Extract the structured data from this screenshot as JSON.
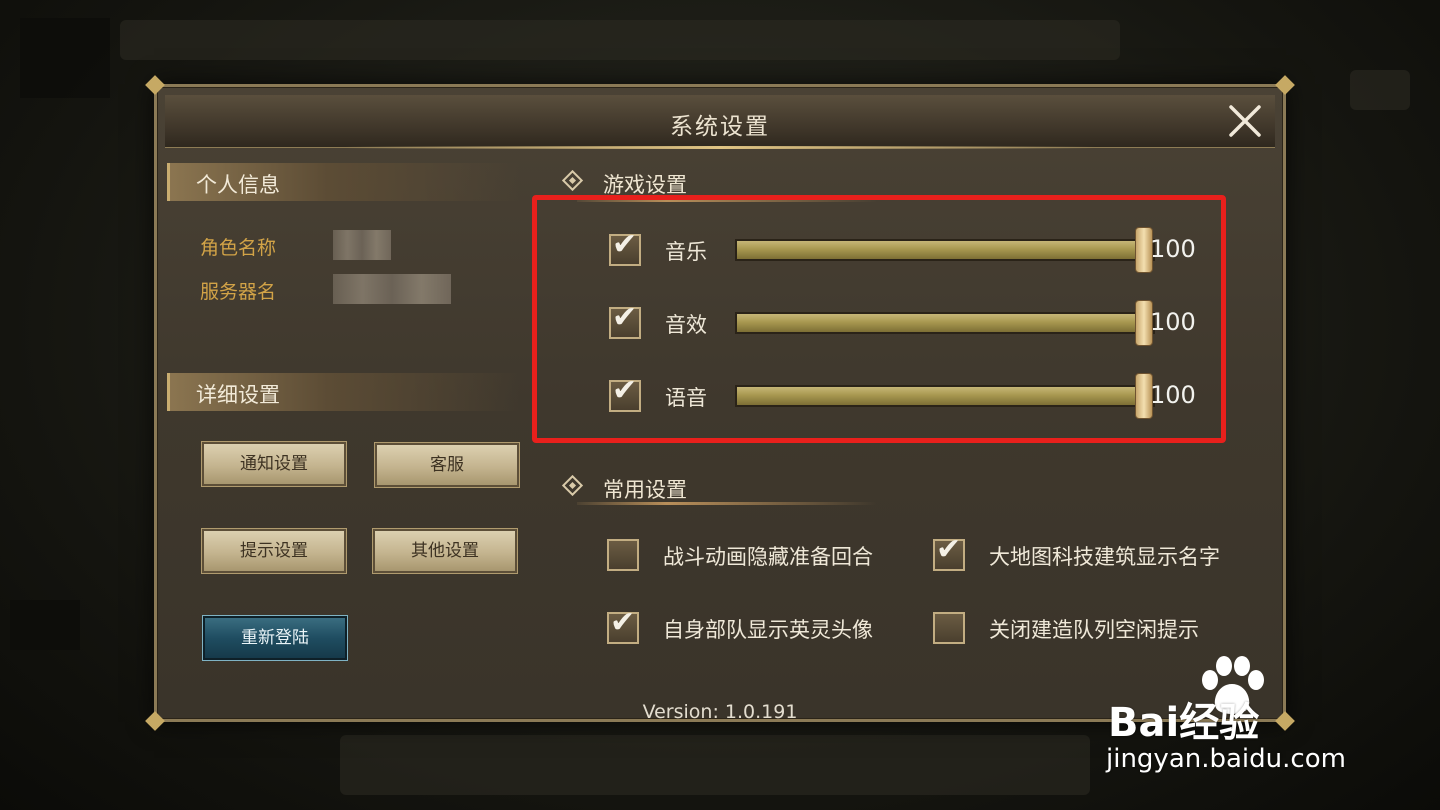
{
  "dialog": {
    "title": "系统设置",
    "close_icon": "close-icon"
  },
  "personal": {
    "section_title": "个人信息",
    "role_label": "角色名称",
    "server_label": "服务器名"
  },
  "detail": {
    "section_title": "详细设置",
    "buttons": [
      "通知设置",
      "客服",
      "提示设置",
      "其他设置",
      "重新登陆"
    ]
  },
  "game_settings": {
    "section_title": "游戏设置",
    "sliders": [
      {
        "label": "音乐",
        "checked": true,
        "value": "100"
      },
      {
        "label": "音效",
        "checked": true,
        "value": "100"
      },
      {
        "label": "语音",
        "checked": true,
        "value": "100"
      }
    ]
  },
  "common_settings": {
    "section_title": "常用设置",
    "options": [
      {
        "label": "战斗动画隐藏准备回合",
        "checked": false
      },
      {
        "label": "大地图科技建筑显示名字",
        "checked": true
      },
      {
        "label": "自身部队显示英灵头像",
        "checked": true
      },
      {
        "label": "关闭建造队列空闲提示",
        "checked": false
      }
    ]
  },
  "version": "Version: 1.0.191",
  "watermark": {
    "brand": "Bai经验",
    "url": "jingyan.baidu.com"
  },
  "colors": {
    "highlight": "#e8201c",
    "label_gold": "#d2a347"
  }
}
